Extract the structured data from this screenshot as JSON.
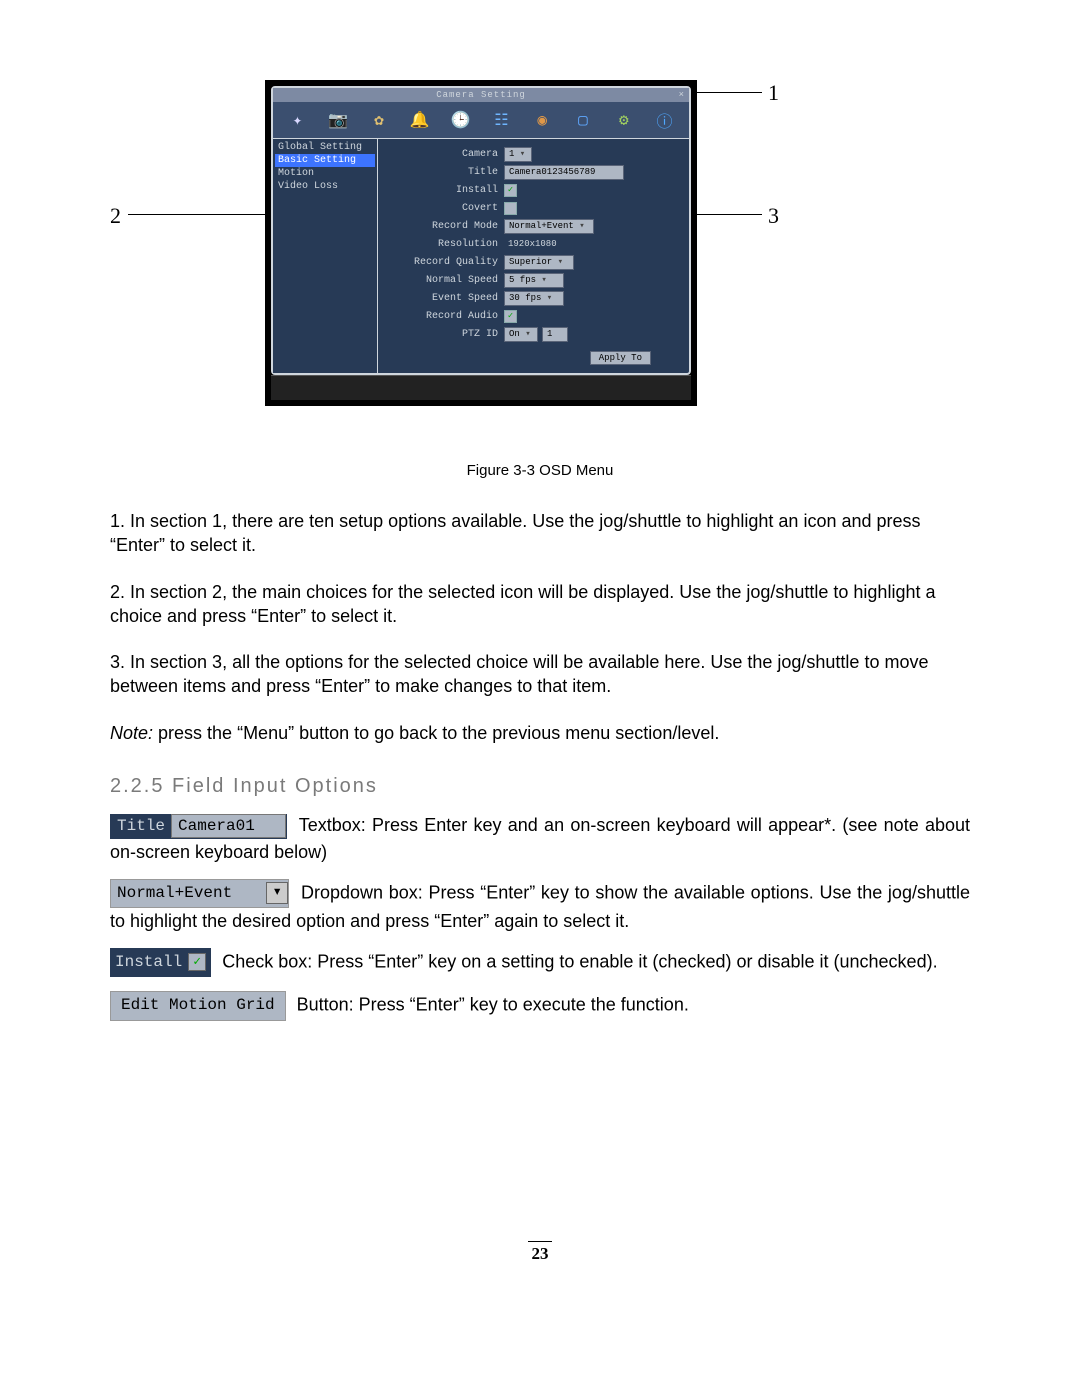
{
  "callouts": {
    "one": "1",
    "two": "2",
    "three": "3"
  },
  "osd": {
    "windowTitle": "Camera Setting",
    "close": "×",
    "sidebar": [
      "Global Setting",
      "Basic Setting",
      "Motion",
      "Video Loss"
    ],
    "rows": {
      "cameraLabel": "Camera",
      "cameraVal": "1",
      "titleLabel": "Title",
      "titleVal": "Camera0123456789",
      "installLabel": "Install",
      "covertLabel": "Covert",
      "recordModeLabel": "Record Mode",
      "recordModeVal": "Normal+Event",
      "resolutionLabel": "Resolution",
      "resolutionVal": "1920x1080",
      "recordQualityLabel": "Record Quality",
      "recordQualityVal": "Superior",
      "normalSpeedLabel": "Normal Speed",
      "normalSpeedVal": "5 fps",
      "eventSpeedLabel": "Event Speed",
      "eventSpeedVal": "30 fps",
      "recordAudioLabel": "Record Audio",
      "ptzIdLabel": "PTZ ID",
      "ptzIdVal1": "On",
      "ptzIdVal2": "1"
    },
    "apply": "Apply To"
  },
  "caption": "Figure 3-3 OSD Menu",
  "paras": {
    "p1": "1. In section 1, there are ten setup options available. Use the jog/shuttle to highlight an icon and press “Enter” to select it.",
    "p2": "2. In section 2, the main choices for the selected icon will be displayed. Use the jog/shuttle to highlight a choice and press “Enter” to select it.",
    "p3": "3. In section 3, all the options for the selected choice will be available here. Use the jog/shuttle to move between items and press “Enter” to make changes to that item.",
    "noteLabel": "Note:",
    "noteRest": " press the “Menu” button to go back to the previous menu section/level."
  },
  "section": "2.2.5  Field Input Options",
  "samples": {
    "titleLbl": "Title",
    "titleVal": "Camera01",
    "titleText": " Textbox: Press Enter key and an on-screen keyboard will appear*. (see note about on-screen keyboard below)",
    "ddVal": "Normal+Event",
    "ddText": " Dropdown box: Press “Enter” key to show the available options. Use the jog/shuttle to highlight the desired option and press “Enter” again to select it.",
    "chkLbl": "Install",
    "chkText": " Check box: Press “Enter” key on a setting to enable it (checked) or disable it (unchecked).",
    "btnLbl": "Edit Motion Grid",
    "btnText": " Button: Press “Enter” key to execute the function."
  },
  "pageNumber": "23"
}
